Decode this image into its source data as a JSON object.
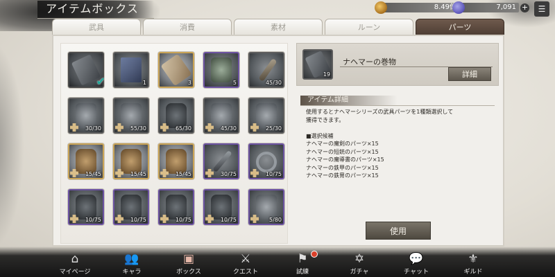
{
  "header": {
    "title": "アイテムボックス",
    "gold_value": "8.49億",
    "gem_value": "7,091",
    "gold_icon": "coin-icon",
    "gem_icon": "gem-icon",
    "menu_icon": "menu-icon"
  },
  "tabs": [
    {
      "label": "武具"
    },
    {
      "label": "消費"
    },
    {
      "label": "素材"
    },
    {
      "label": "ルーン"
    },
    {
      "label": "パーツ"
    }
  ],
  "active_tab": "パーツ",
  "items": [
    {
      "count": "",
      "rarity": "gray",
      "art": "scroll",
      "selected": true
    },
    {
      "count": "1",
      "rarity": "gray",
      "art": "book"
    },
    {
      "count": "3",
      "rarity": "gold",
      "art": "scroll2"
    },
    {
      "count": "5",
      "rarity": "purple",
      "art": "armor"
    },
    {
      "count": "45/30",
      "rarity": "gray",
      "art": "sword"
    },
    {
      "count": "30/30",
      "rarity": "gray",
      "art": "metal"
    },
    {
      "count": "55/30",
      "rarity": "gray",
      "art": "metal"
    },
    {
      "count": "65/30",
      "rarity": "gray",
      "art": "dark"
    },
    {
      "count": "45/30",
      "rarity": "gray",
      "art": "metal"
    },
    {
      "count": "25/30",
      "rarity": "gray",
      "art": "metal"
    },
    {
      "count": "15/45",
      "rarity": "gold",
      "art": "brown"
    },
    {
      "count": "15/45",
      "rarity": "gold",
      "art": "brown"
    },
    {
      "count": "15/45",
      "rarity": "gold",
      "art": "brown"
    },
    {
      "count": "30/75",
      "rarity": "purple",
      "art": "blade"
    },
    {
      "count": "10/75",
      "rarity": "purple",
      "art": "ring"
    },
    {
      "count": "10/75",
      "rarity": "purple",
      "art": "dark"
    },
    {
      "count": "10/75",
      "rarity": "purple",
      "art": "dark"
    },
    {
      "count": "10/75",
      "rarity": "purple",
      "art": "dark"
    },
    {
      "count": "10/75",
      "rarity": "purple",
      "art": "dark"
    },
    {
      "count": "5/80",
      "rarity": "purple",
      "art": "metal"
    }
  ],
  "detail": {
    "name": "ナヘマーの巻物",
    "count": "19",
    "button": "詳細",
    "section_title": "アイテム詳細",
    "description": "使用するとナヘマーシリーズの武具パーツを1種類選択して\n獲得できます。\n\n■選択候補\nナヘマーの魔剣のパーツ×15\nナヘマーの短銃のパーツ×15\nナヘマーの魔導書のパーツ×15\nナヘマーの鉄甲のパーツ×15\nナヘマーの鉄冑のパーツ×15",
    "use_button": "使用"
  },
  "nav": [
    {
      "label": "マイページ",
      "icon": "home-icon",
      "glyph": "⌂"
    },
    {
      "label": "キャラ",
      "icon": "characters-icon",
      "glyph": "👥"
    },
    {
      "label": "ボックス",
      "icon": "box-icon",
      "glyph": "▣",
      "active": true
    },
    {
      "label": "クエスト",
      "icon": "crossed-swords-icon",
      "glyph": "⚔"
    },
    {
      "label": "試練",
      "icon": "trial-icon",
      "glyph": "⚑",
      "badge": true
    },
    {
      "label": "ガチャ",
      "icon": "gacha-icon",
      "glyph": "✡"
    },
    {
      "label": "チャット",
      "icon": "chat-icon",
      "glyph": "💬"
    },
    {
      "label": "ギルド",
      "icon": "guild-icon",
      "glyph": "⚜"
    }
  ],
  "colors": {
    "active_tab": "#5a473c",
    "gold_rarity": "#caa456",
    "purple_rarity": "#6d53a3",
    "check": "#21a89a",
    "badge": "#d9402a"
  }
}
